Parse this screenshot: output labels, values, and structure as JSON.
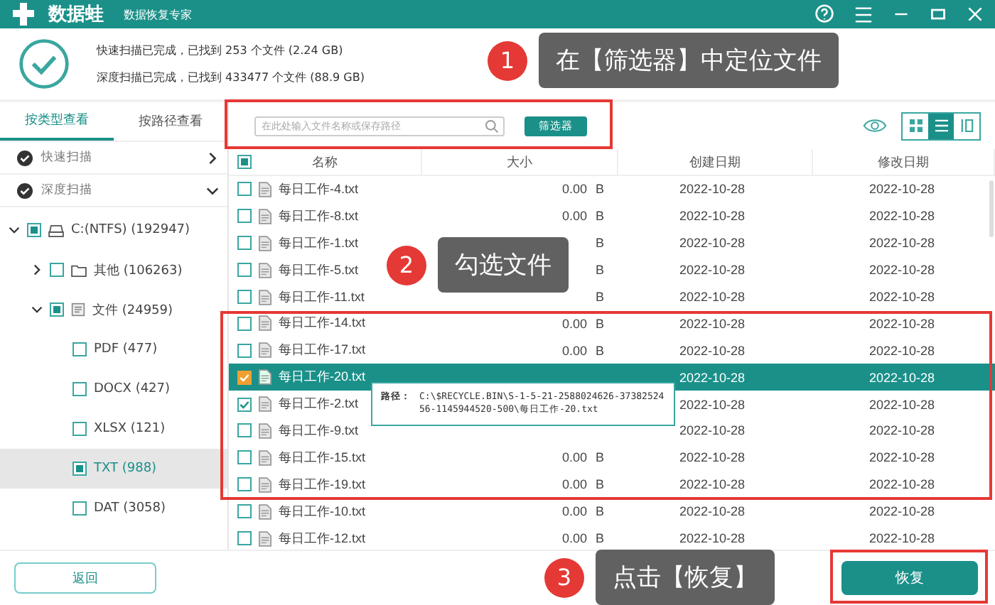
{
  "title_bar": {
    "app_name": "数据蛙",
    "subtitle": "数据恢复专家"
  },
  "scan_summary": [
    "快速扫描已完成，已找到 253 个文件 (2.24 GB)",
    "深度扫描已完成，已找到 433477 个文件 (88.9 GB)"
  ],
  "view_tabs": [
    {
      "label": "按类型查看",
      "selected": true
    },
    {
      "label": "按路径查看",
      "selected": false
    }
  ],
  "scans": [
    {
      "label": "快速扫描",
      "expanded": false
    },
    {
      "label": "深度扫描",
      "expanded": true
    }
  ],
  "tree": [
    {
      "label": "C:(NTFS) (192947)",
      "kind": "drive",
      "checked": true,
      "expanded": true,
      "selected": false,
      "children": [
        {
          "label": "其他 (106263)",
          "kind": "folder",
          "checked": false,
          "expanded": false,
          "selected": false
        },
        {
          "label": "文件 (24959)",
          "kind": "document",
          "checked": true,
          "expanded": true,
          "selected": false,
          "children": [
            {
              "label": "PDF (477)",
              "checked": false,
              "selected": false
            },
            {
              "label": "DOCX (427)",
              "checked": false,
              "selected": false
            },
            {
              "label": "XLSX (121)",
              "checked": false,
              "selected": false
            },
            {
              "label": "TXT (988)",
              "checked": true,
              "selected": true
            },
            {
              "label": "DAT (3058)",
              "checked": false,
              "selected": false
            }
          ]
        }
      ]
    }
  ],
  "search": {
    "placeholder": "在此处输入文件名称或保存路径"
  },
  "filter_button": "筛选器",
  "view_modes": [
    {
      "kind": "grid",
      "selected": false
    },
    {
      "kind": "list",
      "selected": true
    },
    {
      "kind": "columns",
      "selected": false
    }
  ],
  "table": {
    "header_checked": true,
    "columns": [
      "名称",
      "大小",
      "创建日期",
      "修改日期"
    ],
    "rows": [
      {
        "name": "每日工作-4.txt",
        "size": "0.00",
        "unit": "B",
        "created": "2022-10-28",
        "modified": "2022-10-28",
        "checked": false,
        "selected": false
      },
      {
        "name": "每日工作-8.txt",
        "size": "0.00",
        "unit": "B",
        "created": "2022-10-28",
        "modified": "2022-10-28",
        "checked": false,
        "selected": false
      },
      {
        "name": "每日工作-1.txt",
        "unit": "B",
        "created": "2022-10-28",
        "modified": "2022-10-28",
        "checked": false,
        "selected": false
      },
      {
        "name": "每日工作-5.txt",
        "unit": "B",
        "created": "2022-10-28",
        "modified": "2022-10-28",
        "checked": false,
        "selected": false
      },
      {
        "name": "每日工作-11.txt",
        "unit": "B",
        "created": "2022-10-28",
        "modified": "2022-10-28",
        "checked": false,
        "selected": false
      },
      {
        "name": "每日工作-14.txt",
        "size": "0.00",
        "unit": "B",
        "created": "2022-10-28",
        "modified": "2022-10-28",
        "checked": false,
        "selected": false
      },
      {
        "name": "每日工作-17.txt",
        "size": "0.00",
        "unit": "B",
        "created": "2022-10-28",
        "modified": "2022-10-28",
        "checked": false,
        "selected": false
      },
      {
        "name": "每日工作-20.txt",
        "created": "2022-10-28",
        "modified": "2022-10-28",
        "checked": true,
        "selected": true
      },
      {
        "name": "每日工作-2.txt",
        "created": "2022-10-28",
        "modified": "2022-10-28",
        "checked": true,
        "selected": false
      },
      {
        "name": "每日工作-9.txt",
        "created": "2022-10-28",
        "modified": "2022-10-28",
        "checked": false,
        "selected": false
      },
      {
        "name": "每日工作-15.txt",
        "size": "0.00",
        "unit": "B",
        "created": "2022-10-28",
        "modified": "2022-10-28",
        "checked": false,
        "selected": false
      },
      {
        "name": "每日工作-19.txt",
        "size": "0.00",
        "unit": "B",
        "created": "2022-10-28",
        "modified": "2022-10-28",
        "checked": false,
        "selected": false
      },
      {
        "name": "每日工作-10.txt",
        "size": "0.00",
        "unit": "B",
        "created": "2022-10-28",
        "modified": "2022-10-28",
        "checked": false,
        "selected": false
      },
      {
        "name": "每日工作-12.txt",
        "size": "0.00",
        "unit": "B",
        "created": "2022-10-28",
        "modified": "2022-10-28",
        "checked": false,
        "selected": false
      }
    ]
  },
  "tooltip": {
    "label": "路径：",
    "path": "C:\\$RECYCLE.BIN\\S-1-5-21-2588024626-3738252456-1145944520-500\\每日工作-20.txt"
  },
  "back_button": "返回",
  "recover_button": "恢复",
  "callouts": [
    {
      "number": "1",
      "text": "在【筛选器】中定位文件"
    },
    {
      "number": "2",
      "text": "勾选文件"
    },
    {
      "number": "3",
      "text": "点击【恢复】"
    }
  ]
}
